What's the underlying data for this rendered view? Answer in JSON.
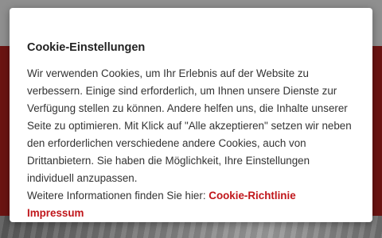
{
  "colors": {
    "accent": "#c0161b",
    "hero_background": "#6b1412",
    "header_background": "#8f8f8f",
    "modal_background": "#ffffff"
  },
  "cookie_dialog": {
    "title": "Cookie-Einstellungen",
    "description": "Wir verwenden Cookies, um Ihr Erlebnis auf der Website zu verbessern. Einige sind erforderlich, um Ihnen unsere Dienste zur Verfügung stellen zu können. Andere helfen uns, die Inhalte unserer Seite zu optimieren. Mit Klick auf \"Alle akzeptieren\" setzen wir neben den erforderlichen verschiedene andere Cookies, auch von Drittanbietern. Sie haben die Möglichkeit, Ihre Einstellungen individuell anzupassen.",
    "more_info_prefix": "Weitere Informationen finden Sie hier:",
    "links": {
      "cookie_policy": "Cookie-Richtlinie",
      "imprint": "Impressum"
    }
  }
}
